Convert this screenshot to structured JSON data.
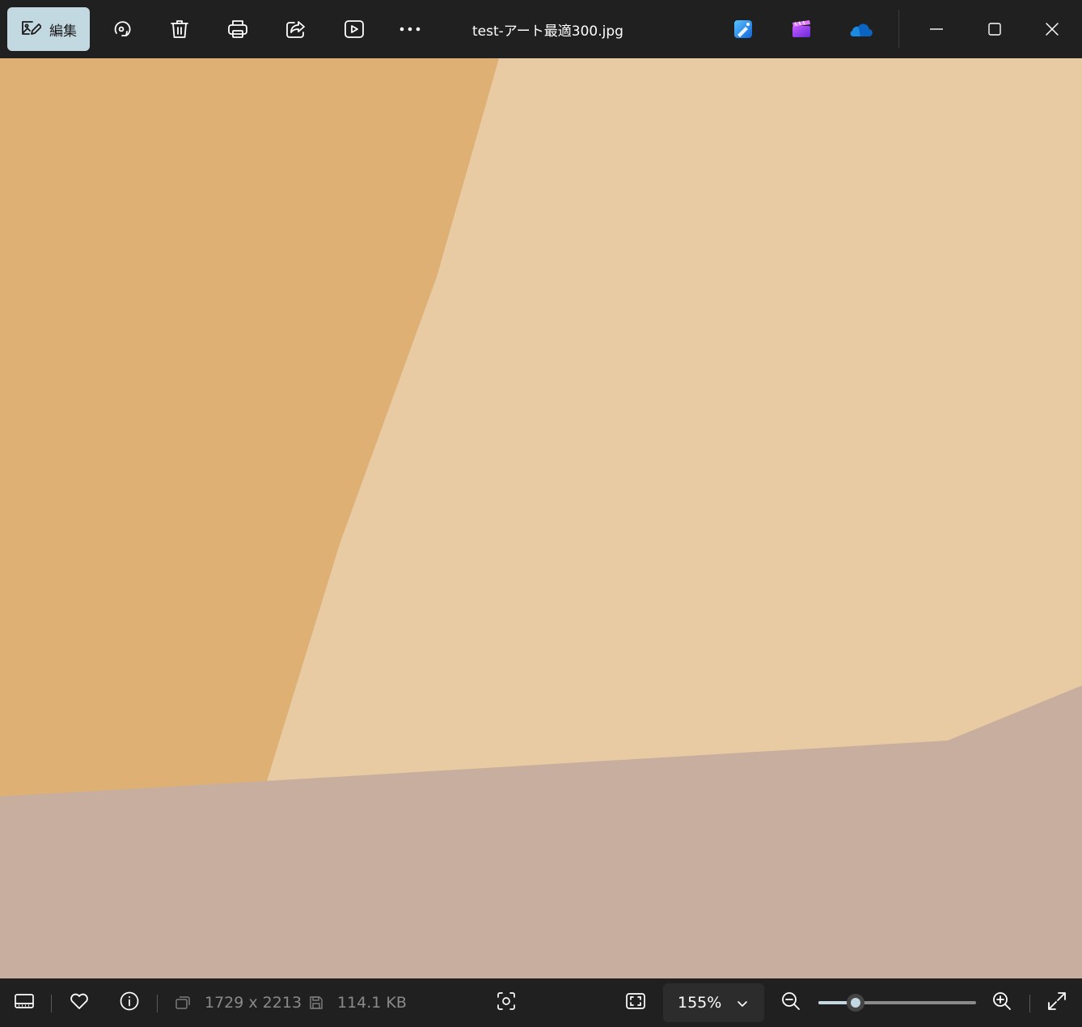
{
  "toolbar": {
    "edit_label": "編集",
    "buttons": {
      "rotate": "rotate-icon",
      "delete": "trash-icon",
      "print": "print-icon",
      "share": "share-icon",
      "slideshow": "slideshow-icon",
      "more": "more-icon"
    },
    "title": "test-アート最適300.jpg",
    "apps": [
      "photo-editor-app-icon",
      "clipchamp-app-icon",
      "onedrive-icon"
    ]
  },
  "window_controls": [
    "minimize-icon",
    "maximize-icon",
    "close-icon"
  ],
  "image_colors": {
    "left_region": "#dfb073",
    "right_region": "#e8caa3",
    "bottom_region": "#c8ae9e"
  },
  "statusbar": {
    "dimensions": "1729 x 2213",
    "file_size": "114.1 KB",
    "zoom": "155%",
    "zoom_slider_fraction": 0.235
  },
  "colors": {
    "accent": "#c3d9e1",
    "background": "#202020"
  }
}
